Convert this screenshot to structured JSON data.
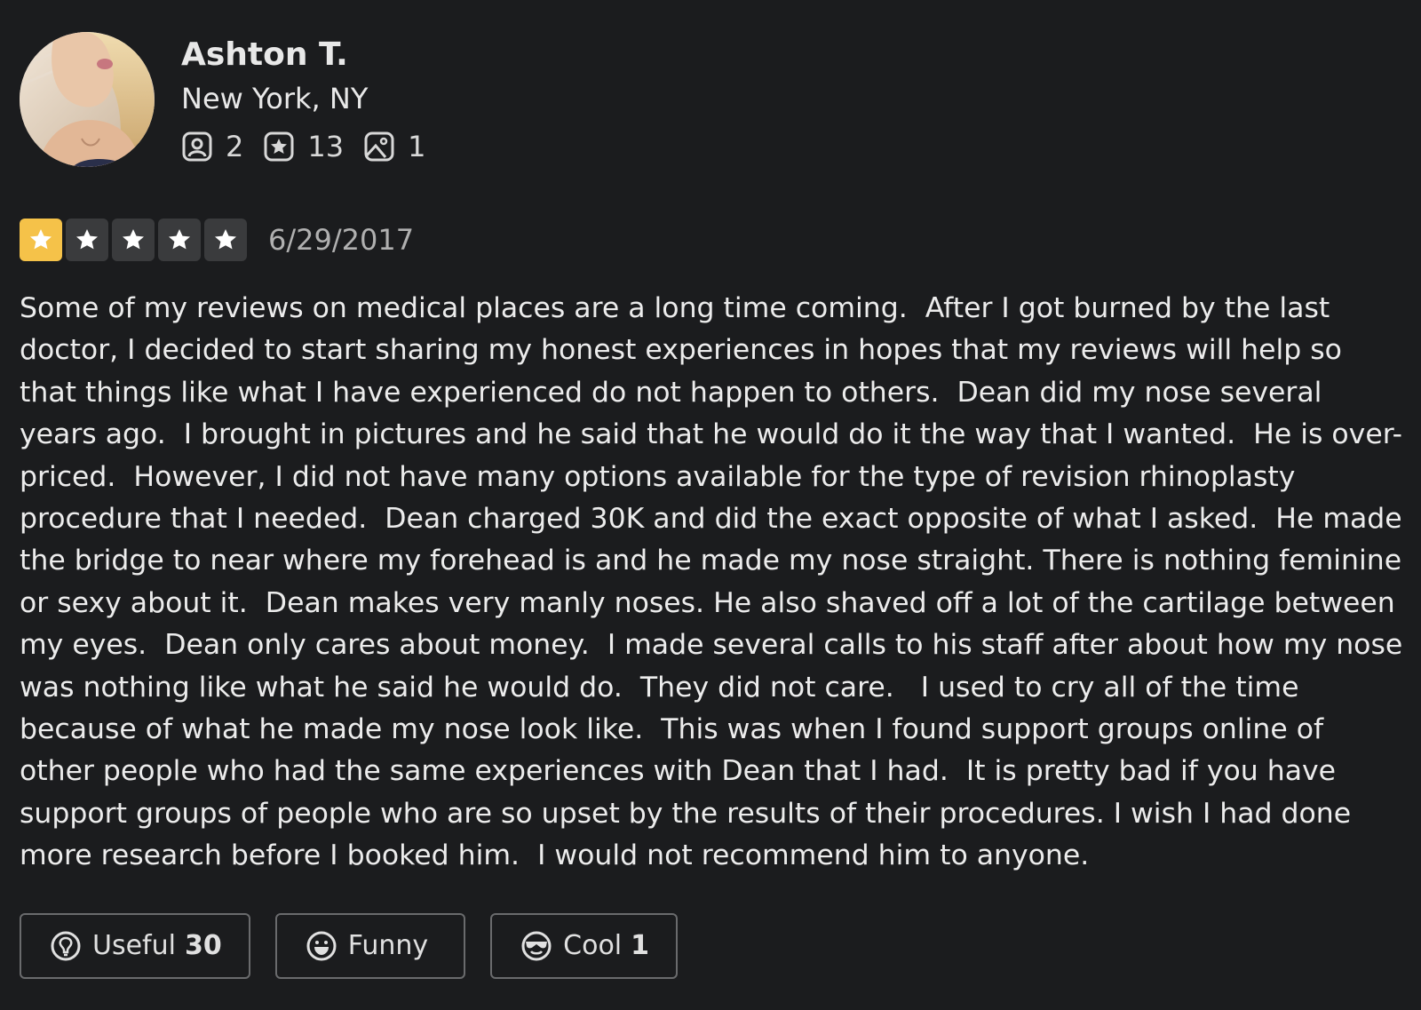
{
  "user": {
    "name": "Ashton T.",
    "location": "New York, NY",
    "avatar_icon": "user-avatar-photo",
    "stats": {
      "friends": {
        "icon": "friends-icon",
        "value": "2"
      },
      "reviews": {
        "icon": "review-star-icon",
        "value": "13"
      },
      "photos": {
        "icon": "photo-icon",
        "value": "1"
      }
    }
  },
  "review": {
    "rating": 1,
    "max_rating": 5,
    "date": "6/29/2017",
    "text": "Some of my reviews on medical places are a long time coming.  After I got burned by the last doctor, I decided to start sharing my honest experiences in hopes that my reviews will help so that things like what I have experienced do not happen to others.  Dean did my nose several years ago.  I brought in pictures and he said that he would do it the way that I wanted.  He is over-priced.  However, I did not have many options available for the type of revision rhinoplasty procedure that I needed.  Dean charged 30K and did the exact opposite of what I asked.  He made the bridge to near where my forehead is and he made my nose straight. There is nothing feminine or sexy about it.  Dean makes very manly noses. He also shaved off a lot of the cartilage between my eyes.  Dean only cares about money.  I made several calls to his staff after about how my nose was nothing like what he said he would do.  They did not care.   I used to cry all of the time because of what he made my nose look like.  This was when I found support groups online of other people who had the same experiences with Dean that I had.  It is pretty bad if you have support groups of people who are so upset by the results of their procedures. I wish I had done more research before I booked him.  I would not recommend him to anyone."
  },
  "actions": {
    "useful": {
      "label": "Useful",
      "count": "30",
      "icon": "useful-icon"
    },
    "funny": {
      "label": "Funny",
      "count": "",
      "icon": "funny-icon"
    },
    "cool": {
      "label": "Cool",
      "count": "1",
      "icon": "cool-icon"
    }
  },
  "colors": {
    "background": "#1b1c1e",
    "star_filled": "#f5c249",
    "star_empty": "#3a3b3d",
    "text": "#e8e8e8"
  }
}
